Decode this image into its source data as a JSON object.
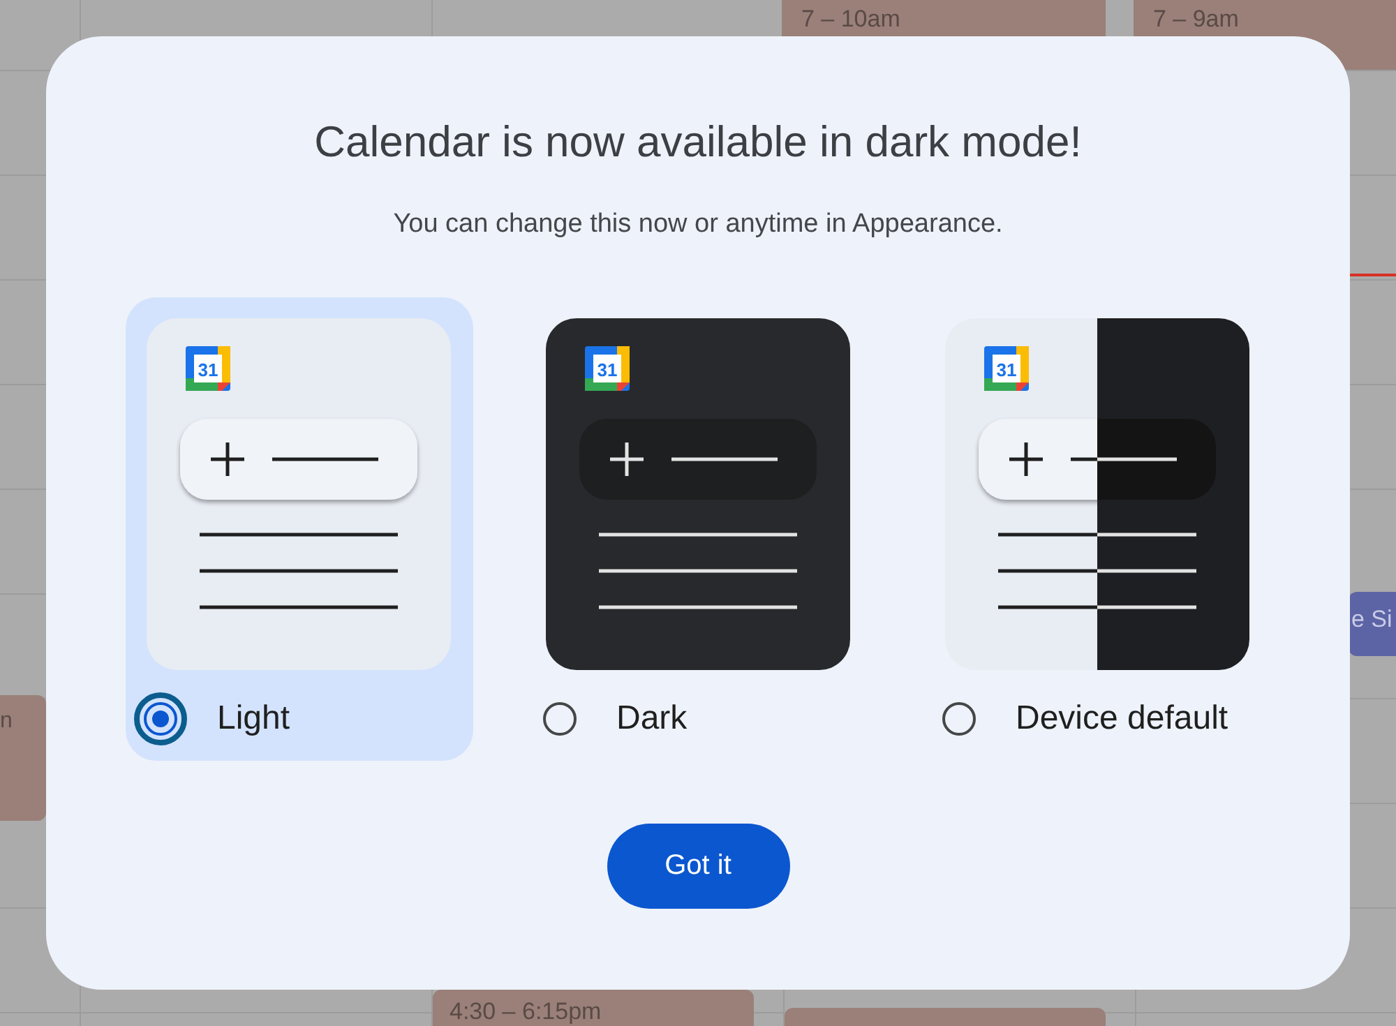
{
  "calendar_background": {
    "events": [
      {
        "text": "7 – 10am",
        "color": "#9a8079"
      },
      {
        "text": "7 – 9am",
        "color": "#9a8079"
      },
      {
        "text": "e Si",
        "color": "#5c64a6"
      },
      {
        "text": "n",
        "color": "#9a8079"
      },
      {
        "text": "4:30 – 6:15pm",
        "color": "#9a8079"
      },
      {
        "color": "#9a8079"
      }
    ],
    "current_time_line": true
  },
  "dialog": {
    "title": "Calendar is now available in dark mode!",
    "subtitle": "You can change this now or anytime in Appearance.",
    "options": [
      {
        "kind": "light",
        "label": "Light",
        "logo_text": "31",
        "selected": true
      },
      {
        "kind": "dark",
        "label": "Dark",
        "logo_text": "31",
        "selected": false
      },
      {
        "kind": "split",
        "label": "Device default",
        "logo_text": "31",
        "selected": false
      }
    ],
    "button": "Got it"
  }
}
